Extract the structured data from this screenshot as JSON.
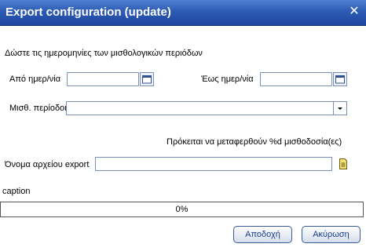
{
  "window": {
    "title": "Export configuration (update)",
    "close_glyph": "✕"
  },
  "form": {
    "instruction": "Δώστε τις ημερομηνίες των μισθολογικών περιόδων",
    "from_date_label": "Από ημερ/νία",
    "from_date_value": "",
    "to_date_label": "Έως ημερ/νία",
    "to_date_value": "",
    "periods_label": "Μισθ. περίοδοι",
    "periods_value": "",
    "transfer_note": "Πρόκειται να μεταφερθούν %d μισθοδοσία(ες)",
    "filename_label": "Όνομα αρχείου export",
    "filename_value": "",
    "caption": "caption"
  },
  "progress": {
    "text": "0%",
    "value": 0
  },
  "buttons": {
    "ok_label": "Αποδοχή",
    "cancel_label": "Ακύρωση"
  },
  "icons": {
    "calendar": "calendar-icon",
    "dropdown": "chevron-down-icon",
    "file": "file-browse-icon",
    "close": "close-icon"
  },
  "colors": {
    "titlebar": "#2d5bb4",
    "button_text": "#1a3f8f"
  }
}
